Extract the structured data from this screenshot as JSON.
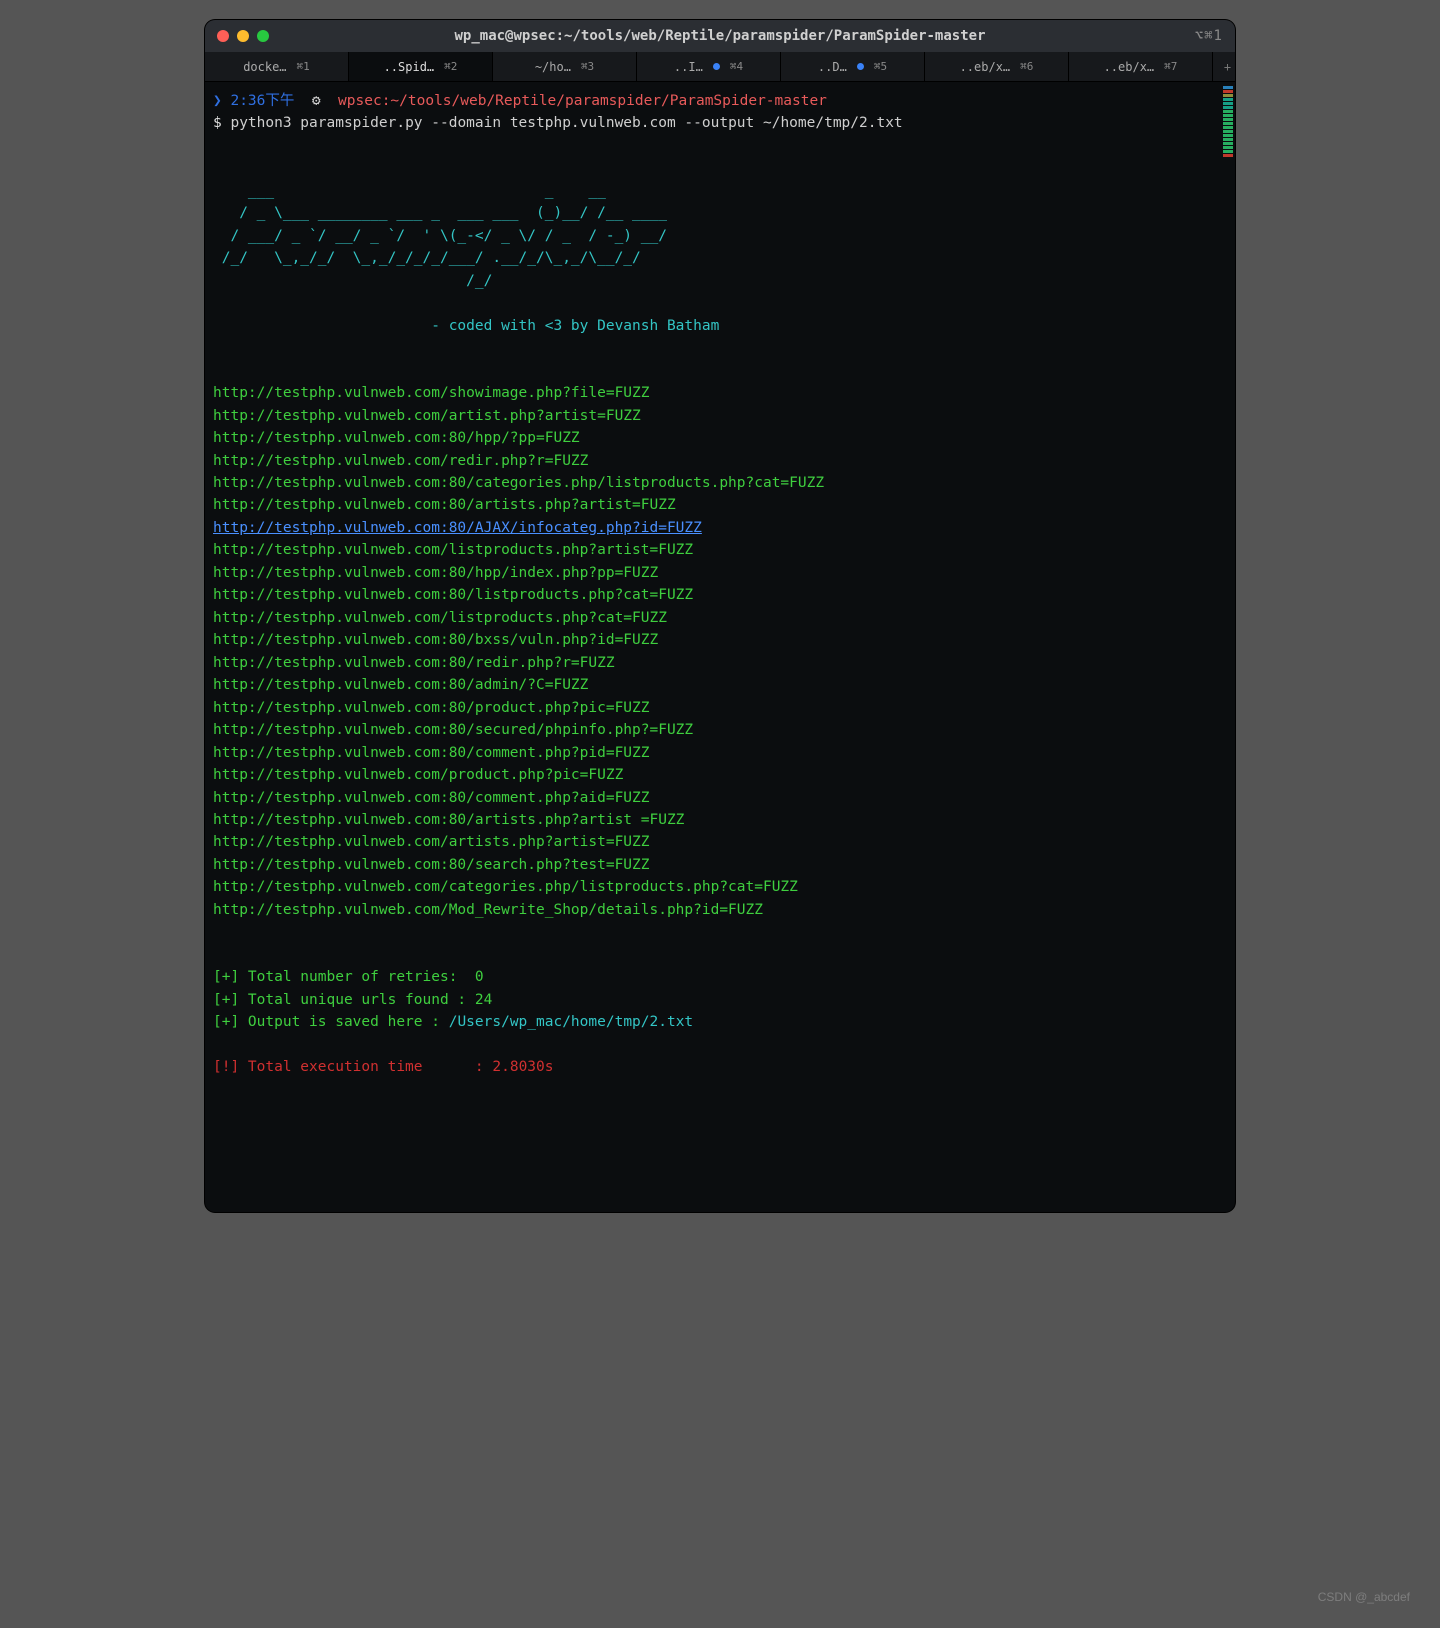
{
  "titlebar": {
    "title": "wp_mac@wpsec:~/tools/web/Reptile/paramspider/ParamSpider-master",
    "right_hint": "⌥⌘1"
  },
  "tabs": [
    {
      "label": "docke…",
      "shortcut": "⌘1",
      "dot": false,
      "active": false
    },
    {
      "label": "..Spid…",
      "shortcut": "⌘2",
      "dot": false,
      "active": true
    },
    {
      "label": "~/ho…",
      "shortcut": "⌘3",
      "dot": false,
      "active": false
    },
    {
      "label": "..I…",
      "shortcut": "⌘4",
      "dot": true,
      "active": false
    },
    {
      "label": "..D…",
      "shortcut": "⌘5",
      "dot": true,
      "active": false
    },
    {
      "label": "..eb/x…",
      "shortcut": "⌘6",
      "dot": false,
      "active": false
    },
    {
      "label": "..eb/x…",
      "shortcut": "⌘7",
      "dot": false,
      "active": false
    }
  ],
  "prompt": {
    "time": "2:36下午",
    "glyph": "⚙",
    "path": "wpsec:~/tools/web/Reptile/paramspider/ParamSpider-master",
    "symbol": "$",
    "command": "python3 paramspider.py --domain testphp.vulnweb.com --output ~/home/tmp/2.txt"
  },
  "ascii": "    ___                               _    __       \n   / _ \\___ ________ ___ _  ___ ___  (_)__/ /__ ____\n  / ___/ _ `/ __/ _ `/  ' \\(_-</ _ \\/ / _  / -_) __/\n /_/   \\_,_/_/  \\_,_/_/_/_/___/ .__/_/\\_,_/\\__/_/   \n                             /_/                     ",
  "ascii_credit": "                         - coded with <3 by Devansh Batham",
  "urls": [
    "http://testphp.vulnweb.com/showimage.php?file=FUZZ",
    "http://testphp.vulnweb.com/artist.php?artist=FUZZ",
    "http://testphp.vulnweb.com:80/hpp/?pp=FUZZ",
    "http://testphp.vulnweb.com/redir.php?r=FUZZ",
    "http://testphp.vulnweb.com:80/categories.php/listproducts.php?cat=FUZZ",
    "http://testphp.vulnweb.com:80/artists.php?artist=FUZZ",
    "http://testphp.vulnweb.com:80/AJAX/infocateg.php?id=FUZZ",
    "http://testphp.vulnweb.com/listproducts.php?artist=FUZZ",
    "http://testphp.vulnweb.com:80/hpp/index.php?pp=FUZZ",
    "http://testphp.vulnweb.com:80/listproducts.php?cat=FUZZ",
    "http://testphp.vulnweb.com/listproducts.php?cat=FUZZ",
    "http://testphp.vulnweb.com:80/bxss/vuln.php?id=FUZZ",
    "http://testphp.vulnweb.com:80/redir.php?r=FUZZ",
    "http://testphp.vulnweb.com:80/admin/?C=FUZZ",
    "http://testphp.vulnweb.com:80/product.php?pic=FUZZ",
    "http://testphp.vulnweb.com:80/secured/phpinfo.php?=FUZZ",
    "http://testphp.vulnweb.com:80/comment.php?pid=FUZZ",
    "http://testphp.vulnweb.com/product.php?pic=FUZZ",
    "http://testphp.vulnweb.com:80/comment.php?aid=FUZZ",
    "http://testphp.vulnweb.com:80/artists.php?artist =FUZZ",
    "http://testphp.vulnweb.com/artists.php?artist=FUZZ",
    "http://testphp.vulnweb.com:80/search.php?test=FUZZ",
    "http://testphp.vulnweb.com/categories.php/listproducts.php?cat=FUZZ",
    "http://testphp.vulnweb.com/Mod_Rewrite_Shop/details.php?id=FUZZ"
  ],
  "link_index": 6,
  "summary": {
    "retries_label": "Total number of retries:",
    "retries_value": "0",
    "urls_label": "Total unique urls found :",
    "urls_value": "24",
    "output_label": "Output is saved here :",
    "output_path": "/Users/wp_mac/home/tmp/2.txt",
    "exec_label": "Total execution time",
    "exec_value": "2.8030s"
  },
  "watermark": "CSDN @_abcdef"
}
